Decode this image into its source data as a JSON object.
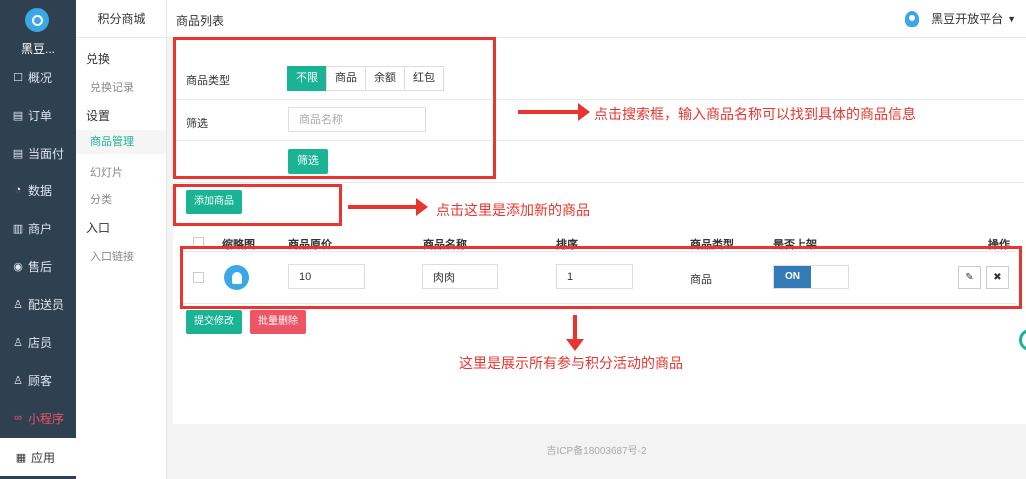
{
  "sidebar": {
    "brand": "黑豆...",
    "items": [
      {
        "icon": "overview-icon",
        "glyph": "☐",
        "label": "概况"
      },
      {
        "icon": "order-icon",
        "glyph": "▤",
        "label": "订单"
      },
      {
        "icon": "facepay-icon",
        "glyph": "▤",
        "label": "当面付"
      },
      {
        "icon": "data-icon",
        "glyph": "◔",
        "label": "数据"
      },
      {
        "icon": "shop-icon",
        "glyph": "▥",
        "label": "商户"
      },
      {
        "icon": "aftersale-icon",
        "glyph": "◉",
        "label": "售后"
      },
      {
        "icon": "courier-icon",
        "glyph": "♙",
        "label": "配送员"
      },
      {
        "icon": "clerk-icon",
        "glyph": "♙",
        "label": "店员"
      },
      {
        "icon": "customer-icon",
        "glyph": "♙",
        "label": "顾客"
      },
      {
        "icon": "miniprogram-icon",
        "glyph": "∞",
        "label": "小程序"
      },
      {
        "icon": "apps-icon",
        "glyph": "▦",
        "label": "应用"
      }
    ]
  },
  "submenu": {
    "title": "积分商城",
    "group_exchange": "兑换",
    "exchange_records": "兑换记录",
    "group_settings": "设置",
    "goods_manage": "商品管理",
    "slides": "幻灯片",
    "category": "分类",
    "group_entry": "入口",
    "entry_link": "入口链接"
  },
  "header": {
    "page_title": "商品列表",
    "platform": "黑豆开放平台"
  },
  "filter": {
    "type_label": "商品类型",
    "type_options": [
      "不限",
      "商品",
      "余额",
      "红包"
    ],
    "selected_type": "不限",
    "filter_label": "筛选",
    "search_placeholder": "商品名称",
    "filter_button": "筛选"
  },
  "actions": {
    "add_button": "添加商品",
    "submit_button": "提交修改",
    "batch_delete_button": "批量删除"
  },
  "table": {
    "columns": [
      "缩略图",
      "商品原价",
      "商品名称",
      "排序",
      "商品类型",
      "是否上架",
      "操作"
    ],
    "rows": [
      {
        "price": "10",
        "name": "肉肉",
        "sort": "1",
        "type": "商品",
        "listed": "ON"
      }
    ]
  },
  "annotations": {
    "search": "点击搜索框，输入商品名称可以找到具体的商品信息",
    "add": "点击这里是添加新的商品",
    "list": "这里是展示所有参与积分活动的商品"
  },
  "footer": {
    "icp": "吉ICP备18003687号-2"
  },
  "colors": {
    "sidebar_bg": "#2f4050",
    "primary_green": "#1ab394",
    "danger_red": "#ed5565",
    "toggle_blue": "#337ab7",
    "annotation_red": "#e8352f"
  }
}
